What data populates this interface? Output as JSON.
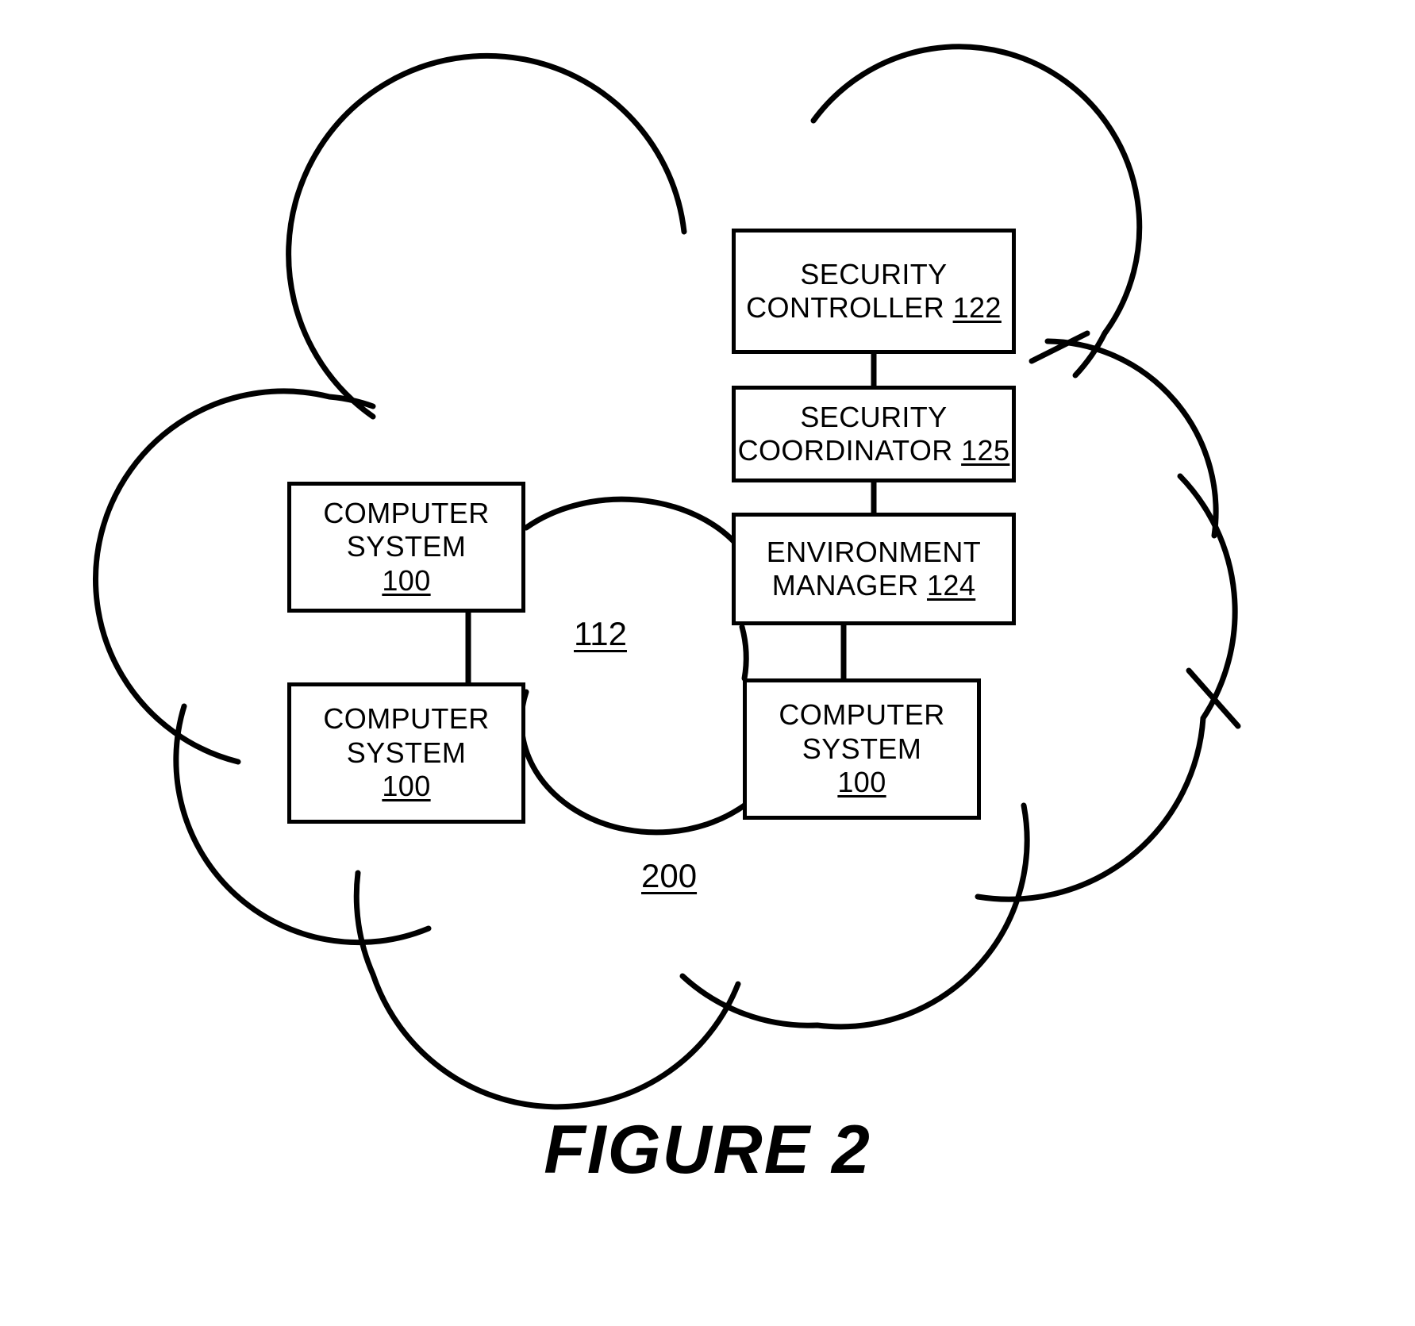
{
  "figure": {
    "caption": "FIGURE 2",
    "cloud_outer_ref": "200",
    "cloud_inner_ref": "112"
  },
  "nodes": {
    "security_controller": {
      "line1": "SECURITY",
      "line2": "CONTROLLER",
      "ref": "122"
    },
    "security_coordinator": {
      "line1": "SECURITY",
      "line2": "COORDINATOR",
      "ref": "125"
    },
    "environment_manager": {
      "line1": "ENVIRONMENT",
      "line2": "MANAGER",
      "ref": "124"
    },
    "computer_system_1": {
      "line1": "COMPUTER",
      "line2": "SYSTEM",
      "ref": "100"
    },
    "computer_system_2": {
      "line1": "COMPUTER",
      "line2": "SYSTEM",
      "ref": "100"
    },
    "computer_system_3": {
      "line1": "COMPUTER",
      "line2": "SYSTEM",
      "ref": "100"
    }
  },
  "colors": {
    "stroke": "#000000",
    "background": "#ffffff"
  }
}
